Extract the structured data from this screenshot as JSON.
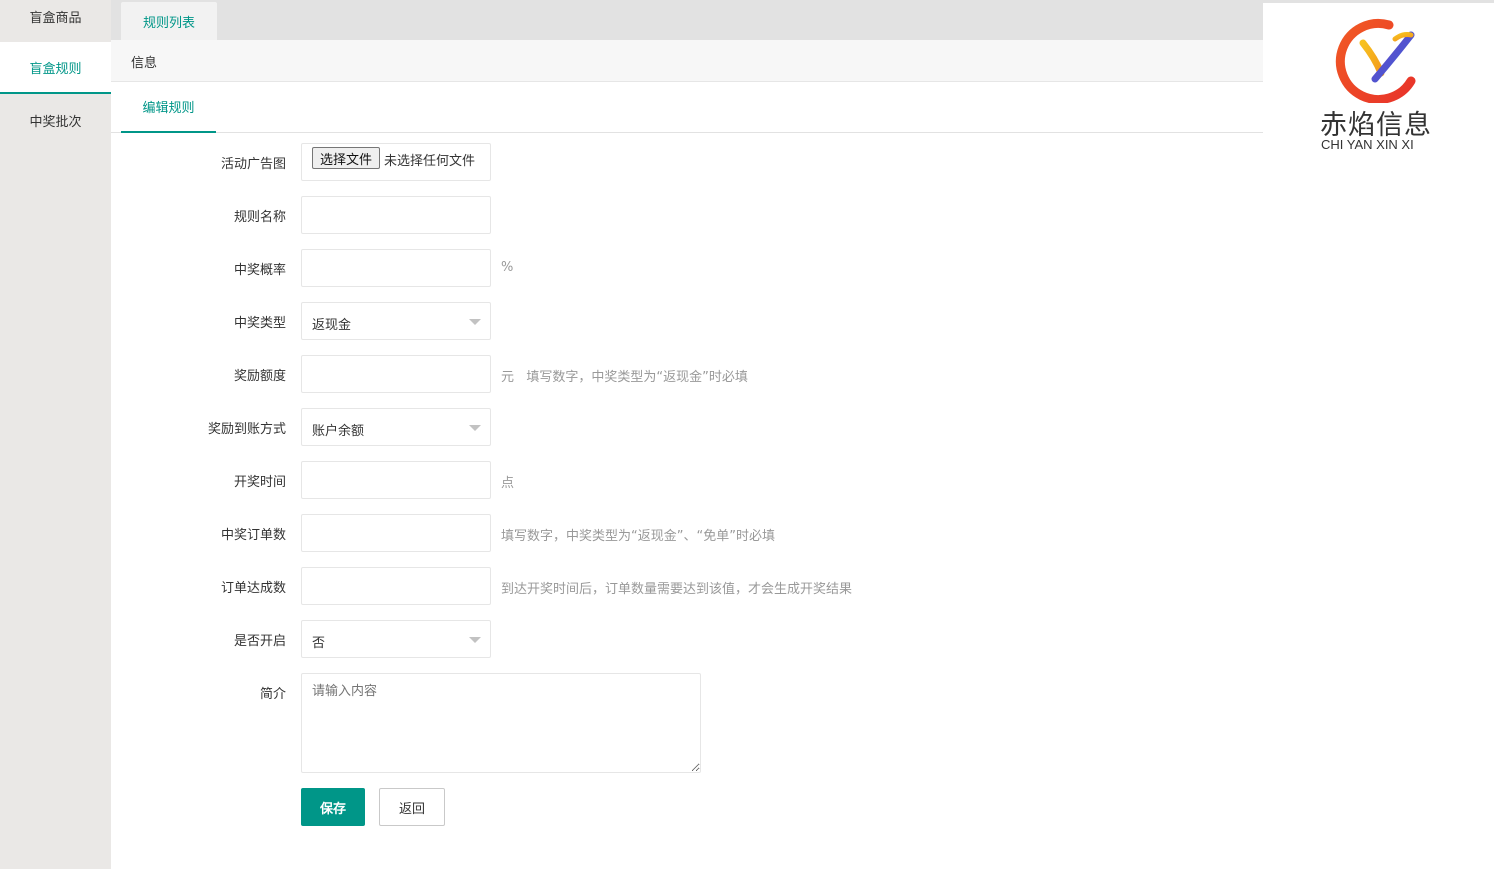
{
  "sidebar": {
    "items": [
      {
        "label": "盲盒商品"
      },
      {
        "label": "盲盒规则"
      },
      {
        "label": "中奖批次"
      }
    ]
  },
  "top_tab": {
    "label": "规则列表"
  },
  "info_bar": {
    "label": "信息"
  },
  "edit_tab": {
    "label": "编辑规则"
  },
  "logo": {
    "name_cn": "赤焰信息",
    "name_en": "CHI YAN XIN XI"
  },
  "form": {
    "ad_image": {
      "label": "活动广告图",
      "button": "选择文件",
      "status": "未选择任何文件"
    },
    "rule_name": {
      "label": "规则名称",
      "value": ""
    },
    "win_rate": {
      "label": "中奖概率",
      "value": "",
      "suffix": "%"
    },
    "prize_type": {
      "label": "中奖类型",
      "selected": "返现金"
    },
    "reward_amount": {
      "label": "奖励额度",
      "value": "",
      "suffix": "元   填写数字，中奖类型为“返现金”时必填"
    },
    "payout_method": {
      "label": "奖励到账方式",
      "selected": "账户余额"
    },
    "draw_time": {
      "label": "开奖时间",
      "value": "",
      "suffix": "点"
    },
    "win_orders": {
      "label": "中奖订单数",
      "value": "",
      "suffix": "填写数字，中奖类型为“返现金”、“免单”时必填"
    },
    "required_orders": {
      "label": "订单达成数",
      "value": "",
      "suffix": "到达开奖时间后，订单数量需要达到该值，才会生成开奖结果"
    },
    "enabled": {
      "label": "是否开启",
      "selected": "否"
    },
    "intro": {
      "label": "简介",
      "placeholder": "请输入内容"
    }
  },
  "buttons": {
    "save": "保存",
    "back": "返回"
  },
  "colors": {
    "accent": "#009688",
    "sidebar_bg": "#eae8e6"
  }
}
